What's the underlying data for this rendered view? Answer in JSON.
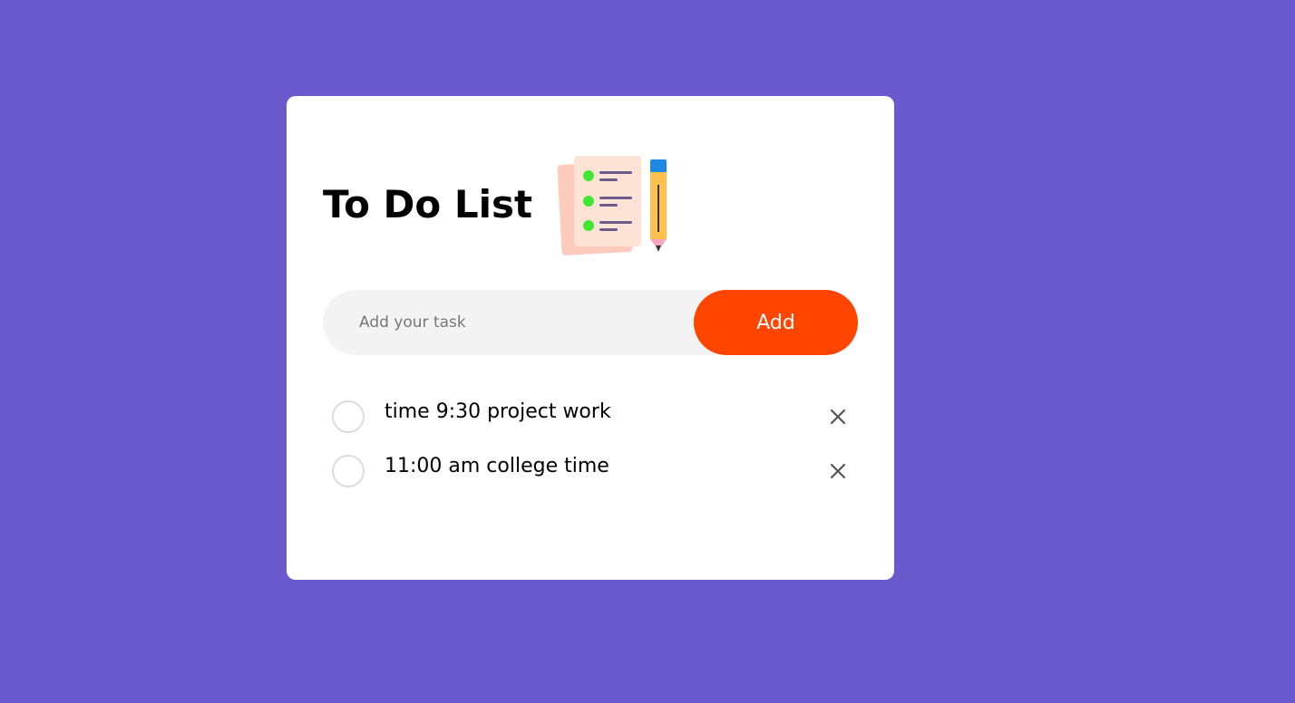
{
  "app": {
    "title": "To Do List",
    "illustration_icon": "checklist-with-pencil-icon"
  },
  "input": {
    "placeholder": "Add your task",
    "value": ""
  },
  "add_button": {
    "label": "Add"
  },
  "tasks": [
    {
      "text": "time 9:30 project work",
      "checked": false
    },
    {
      "text": "11:00 am college time",
      "checked": false
    }
  ],
  "colors": {
    "background": "#6b5acd",
    "card": "#ffffff",
    "accent": "#ff4500",
    "input_bg": "#f3f3f3"
  },
  "icons": {
    "check": "unchecked-circle-icon",
    "remove": "close-icon"
  }
}
